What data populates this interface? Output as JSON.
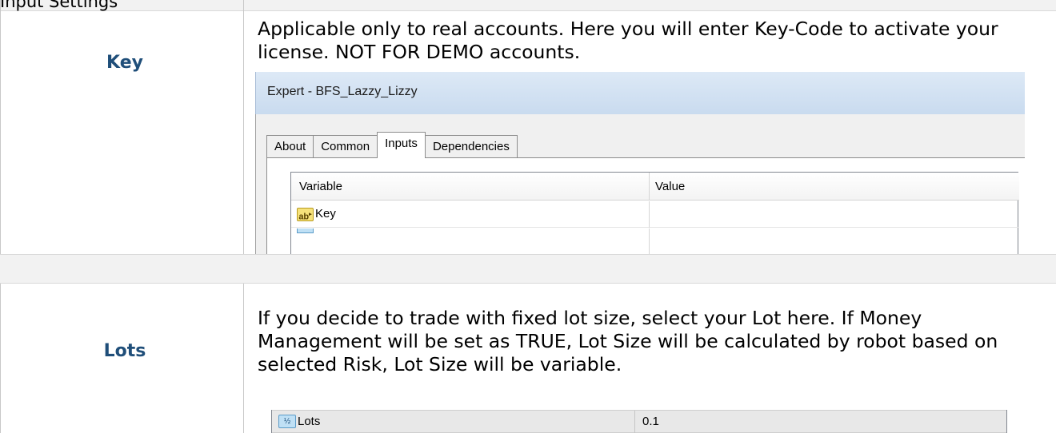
{
  "header_band": {
    "text": "Input Settings"
  },
  "rows": [
    {
      "label": "Key",
      "description": "Applicable only to real accounts. Here you will enter Key-Code to activate your license. NOT FOR DEMO accounts.",
      "dialog": {
        "title": "Expert - BFS_Lazzy_Lizzy",
        "tabs": [
          "About",
          "Common",
          "Inputs",
          "Dependencies"
        ],
        "active_tab": "Inputs",
        "columns": [
          "Variable",
          "Value"
        ],
        "rows": [
          {
            "icon": "ab",
            "variable": "Key",
            "value": ""
          }
        ]
      }
    },
    {
      "label": "Lots",
      "description": "If you decide to trade with fixed lot size, select your Lot here. If Money Management will be set as TRUE, Lot Size will be calculated by robot based on selected Risk, Lot Size will be variable.",
      "table": {
        "rows": [
          {
            "icon": "½",
            "variable": "Lots",
            "value": "0.1"
          }
        ]
      }
    }
  ],
  "icons": {
    "string_type": "ab-string-icon",
    "double_type": "fraction-double-icon"
  },
  "colors": {
    "label_blue": "#1f4e79",
    "band_gray": "#f2f2f2",
    "dialog_title": "#c9dbef"
  }
}
